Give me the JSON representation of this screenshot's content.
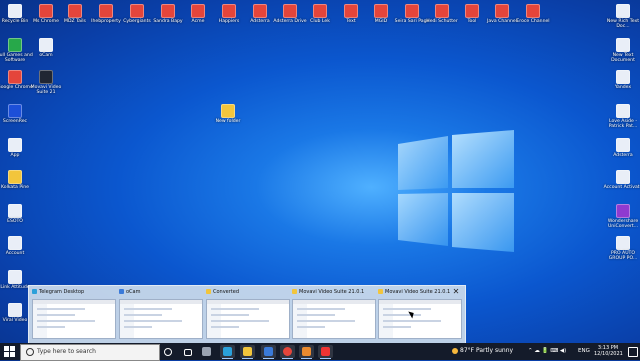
{
  "desktop": {
    "top_row": [
      {
        "label": "Recycle Bin",
        "icon": "recycle-bin-icon",
        "color": "white"
      },
      {
        "label": "Ms Chrome",
        "icon": "chrome-shortcut-icon",
        "color": "red"
      },
      {
        "label": "MDZ Tails",
        "icon": "chrome-shortcut-icon",
        "color": "red"
      },
      {
        "label": "Ihebproperty",
        "icon": "chrome-shortcut-icon",
        "color": "red"
      },
      {
        "label": "Cybergiants",
        "icon": "chrome-shortcut-icon",
        "color": "red"
      },
      {
        "label": "Sandra Bapy",
        "icon": "chrome-shortcut-icon",
        "color": "red"
      },
      {
        "label": "Acme",
        "icon": "chrome-shortcut-icon",
        "color": "red"
      },
      {
        "label": "Happiers",
        "icon": "chrome-shortcut-icon",
        "color": "red"
      },
      {
        "label": "Adsterra",
        "icon": "chrome-shortcut-icon",
        "color": "red"
      },
      {
        "label": "Adsterra Drive",
        "icon": "chrome-shortcut-icon",
        "color": "red"
      },
      {
        "label": "Club Lek",
        "icon": "chrome-shortcut-icon",
        "color": "red"
      },
      {
        "label": "Text",
        "icon": "chrome-shortcut-icon",
        "color": "red"
      },
      {
        "label": "MGID",
        "icon": "chrome-shortcut-icon",
        "color": "red"
      },
      {
        "label": "Seira Sari Page",
        "icon": "chrome-shortcut-icon",
        "color": "red"
      },
      {
        "label": "Hedi Schutter",
        "icon": "chrome-shortcut-icon",
        "color": "red"
      },
      {
        "label": "Tool",
        "icon": "chrome-shortcut-icon",
        "color": "red"
      },
      {
        "label": "Java Channel",
        "icon": "chrome-shortcut-icon",
        "color": "red"
      },
      {
        "label": "Eroce Channel",
        "icon": "chrome-shortcut-icon",
        "color": "red"
      }
    ],
    "left_column": [
      {
        "label": "Full Games and Software",
        "icon": "games-icon",
        "color": "green"
      },
      {
        "label": "Google Chrome",
        "icon": "chrome-icon",
        "color": "red"
      },
      {
        "label": "ScreenRec",
        "icon": "screenrec-icon",
        "color": "blue"
      },
      {
        "label": "App",
        "icon": "file-icon",
        "color": "white"
      },
      {
        "label": "Kolkata Pine",
        "icon": "folder-icon",
        "color": "yel"
      },
      {
        "label": "ESOTO",
        "icon": "file-icon",
        "color": "white"
      },
      {
        "label": "Account",
        "icon": "file-icon",
        "color": "white"
      },
      {
        "label": "Link Attitude",
        "icon": "file-icon",
        "color": "white"
      },
      {
        "label": "Viral Video",
        "icon": "file-icon",
        "color": "white"
      }
    ],
    "second_column": [
      {
        "label": "oCam",
        "icon": "ocam-icon",
        "color": "white"
      },
      {
        "label": "Movavi Video Suite 21",
        "icon": "movavi-icon",
        "color": "dark"
      }
    ],
    "middle": [
      {
        "label": "New folder",
        "icon": "folder-icon",
        "color": "yel"
      }
    ],
    "right_column": [
      {
        "label": "New Rich Text Doc...",
        "icon": "document-icon",
        "color": "white"
      },
      {
        "label": "New Text Document",
        "icon": "document-icon",
        "color": "white"
      },
      {
        "label": "Yandex",
        "icon": "document-icon",
        "color": "white"
      },
      {
        "label": "Love Aside - Patrick Pat...",
        "icon": "document-icon",
        "color": "white"
      },
      {
        "label": "Adsterra",
        "icon": "document-icon",
        "color": "white"
      },
      {
        "label": "Account Activate",
        "icon": "document-icon",
        "color": "white"
      },
      {
        "label": "Wondershare UniConvert...",
        "icon": "wondershare-icon",
        "color": "purple"
      },
      {
        "label": "PRO AUTO GROUP PO...",
        "icon": "file-icon",
        "color": "white"
      }
    ]
  },
  "task_previews": [
    {
      "title": "Telegram Desktop",
      "icon_color": "#2aa0da"
    },
    {
      "title": "oCam",
      "icon_color": "#3a7ad9"
    },
    {
      "title": "Converted",
      "icon_color": "#f2c53c"
    },
    {
      "title": "Movavi Video Suite 21.0.1",
      "icon_color": "#f2c53c"
    },
    {
      "title": "Movavi Video Suite 21.0.1",
      "icon_color": "#f2c53c"
    }
  ],
  "taskbar": {
    "search_placeholder": "Type here to search",
    "apps": [
      {
        "name": "cortana",
        "color": "#ffffff"
      },
      {
        "name": "task-view",
        "color": "#ffffff"
      },
      {
        "name": "settings",
        "color": "#9aa3b2"
      },
      {
        "name": "telegram",
        "color": "#2aa0da"
      },
      {
        "name": "file-explorer",
        "color": "#f2c53c"
      },
      {
        "name": "ocam",
        "color": "#3a7ad9"
      },
      {
        "name": "chrome",
        "color": "#e4453b"
      },
      {
        "name": "movavi",
        "color": "#e98a2f"
      },
      {
        "name": "mobile",
        "color": "#e33"
      }
    ],
    "weather": "87°F  Partly sunny",
    "language": "ENG",
    "time": "3:13 PM",
    "date": "12/10/2021"
  }
}
